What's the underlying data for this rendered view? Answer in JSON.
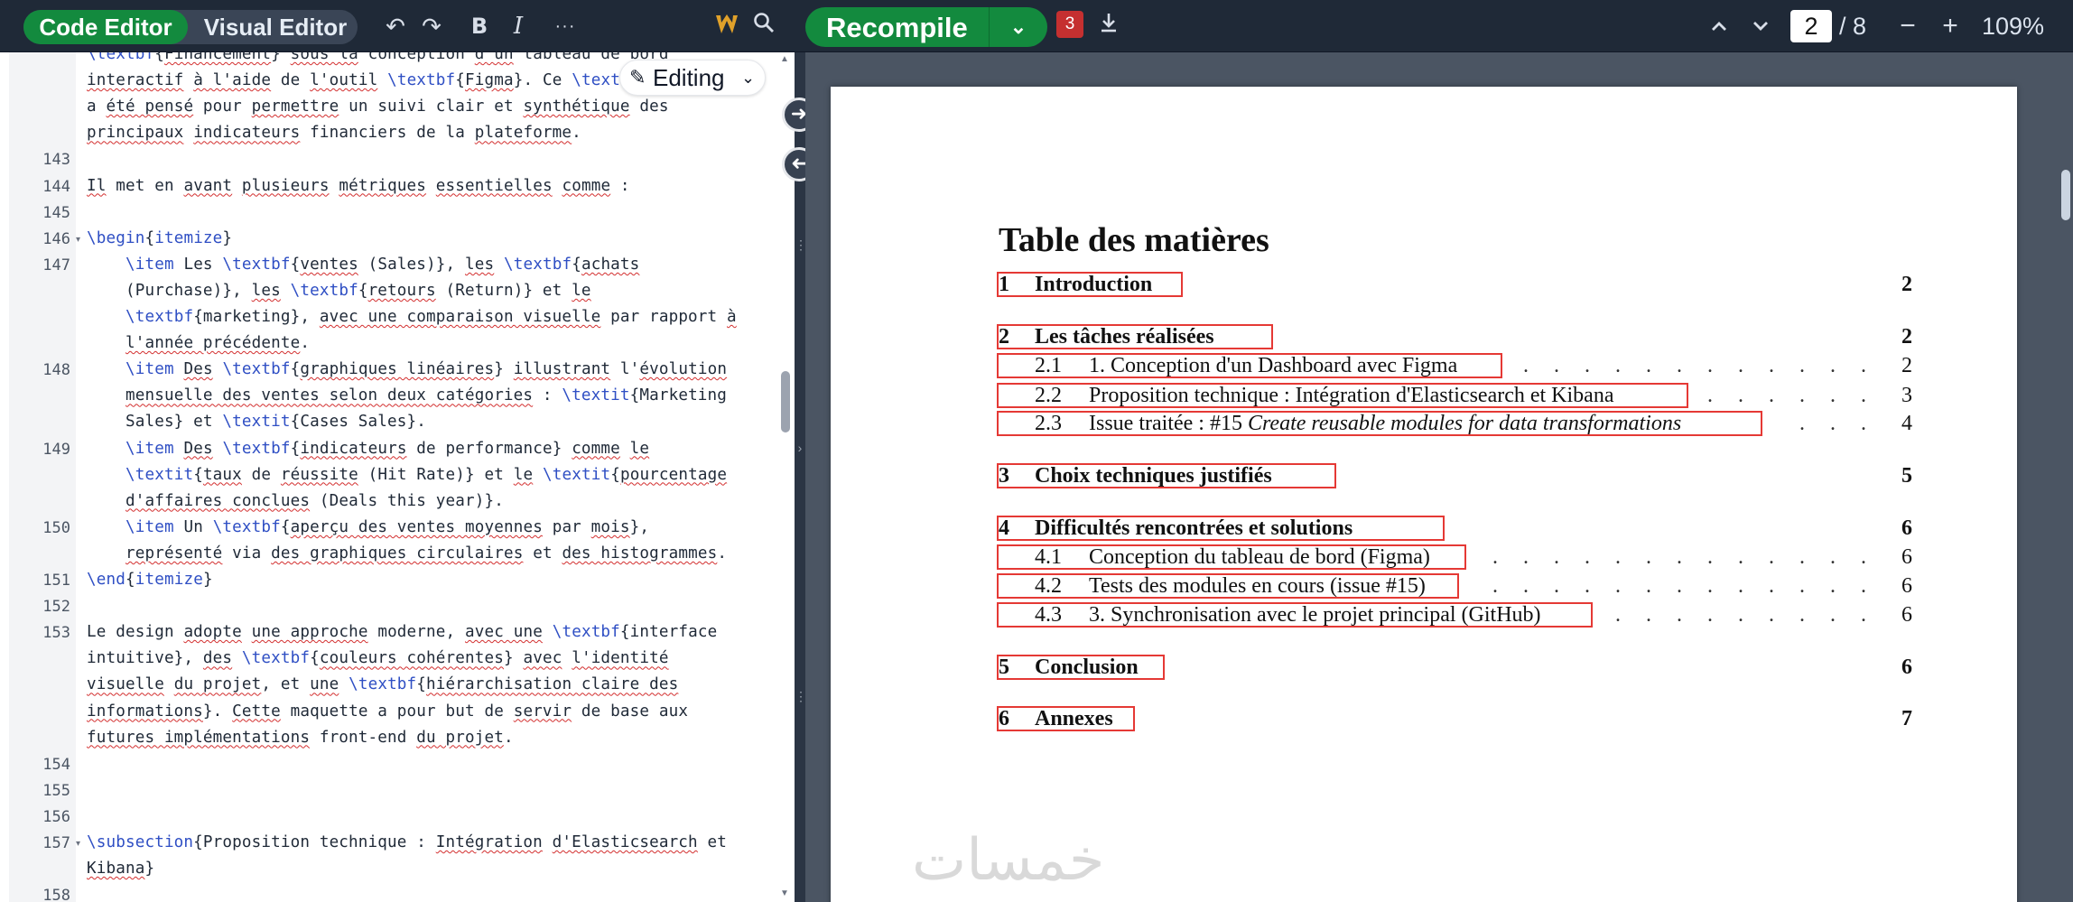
{
  "toolbar": {
    "code_editor_label": "Code Editor",
    "visual_editor_label": "Visual Editor",
    "undo_icon": "↶",
    "redo_icon": "↷",
    "bold_label": "B",
    "italic_label": "I",
    "more_icon": "···",
    "recompile_label": "Recompile",
    "errors_count": "3",
    "page_current": "2",
    "page_total": "/ 8",
    "zoom_level": "109%",
    "zoom_out": "−",
    "zoom_in": "+",
    "editing_label": "Editing"
  },
  "editor": {
    "lines": [
      {
        "n": "",
        "fold": false,
        "html": "<span class=\"k\">\\textbf</span>{<span class=\"s\">Financement</span>} <span class=\"s\">sous la</span> conception <span class=\"s\">d'un</span> tableau de <span class=\"s\">bord</span>"
      },
      {
        "n": "",
        "fold": false,
        "html": "<span class=\"s\">interactif</span> <span class=\"s\">à l'aide</span> de <span class=\"s\">l'outil</span> <span class=\"k\">\\textbf</span>{<span class=\"s\">Figma</span>}. Ce <span class=\"k\">\\textbf</span>"
      },
      {
        "n": "",
        "fold": false,
        "html": "a <span class=\"s\">été pensé</span> pour <span class=\"s\">permettre</span> un suivi clair et <span class=\"s\">synthétique</span> des"
      },
      {
        "n": "",
        "fold": false,
        "html": "<span class=\"s\">principaux</span> <span class=\"s\">indicateurs</span> financiers de la <span class=\"s\">plateforme</span>."
      },
      {
        "n": "143",
        "fold": false,
        "html": ""
      },
      {
        "n": "144",
        "fold": false,
        "html": "<span class=\"s\">Il</span> met en <span class=\"s\">avant</span> <span class=\"s\">plusieurs</span> <span class=\"s\">métriques</span> <span class=\"s\">essentielles</span> <span class=\"s\">comme</span> :"
      },
      {
        "n": "145",
        "fold": false,
        "html": ""
      },
      {
        "n": "146",
        "fold": true,
        "html": "<span class=\"k\">\\begin</span>{<span class=\"k\">itemize</span>}"
      },
      {
        "n": "147",
        "fold": false,
        "html": "    <span class=\"k\">\\item</span> Les <span class=\"k\">\\textbf</span>{<span class=\"s\">ventes</span> (Sales)}, <span class=\"s\">les</span> <span class=\"k\">\\textbf</span>{<span class=\"s\">achats</span>"
      },
      {
        "n": "",
        "fold": false,
        "html": "    (Purchase)}, <span class=\"s\">les</span> <span class=\"k\">\\textbf</span>{<span class=\"s\">retours</span> (Return)} et <span class=\"s\">le</span>"
      },
      {
        "n": "",
        "fold": false,
        "html": "    <span class=\"k\">\\textbf</span>{marketing}, <span class=\"s\">avec une comparaison visuelle</span> par rapport <span class=\"s\">à</span>"
      },
      {
        "n": "",
        "fold": false,
        "html": "    <span class=\"s\">l'année précédente</span>."
      },
      {
        "n": "148",
        "fold": false,
        "html": "    <span class=\"k\">\\item</span> <span class=\"s\">Des</span> <span class=\"k\">\\textbf</span>{<span class=\"s\">graphiques linéaires</span>} <span class=\"s\">illustrant</span> l'<span class=\"s\">évolution</span>"
      },
      {
        "n": "",
        "fold": false,
        "html": "    <span class=\"s\">mensuelle des ventes selon deux catégories</span> : <span class=\"k\">\\textit</span>{Marketing"
      },
      {
        "n": "",
        "fold": false,
        "html": "    Sales} et <span class=\"k\">\\textit</span>{Cases Sales}."
      },
      {
        "n": "149",
        "fold": false,
        "html": "    <span class=\"k\">\\item</span> <span class=\"s\">Des</span> <span class=\"k\">\\textbf</span>{<span class=\"s\">indicateurs</span> de performance} <span class=\"s\">comme</span> <span class=\"s\">le</span>"
      },
      {
        "n": "",
        "fold": false,
        "html": "    <span class=\"k\">\\textit</span>{<span class=\"s\">taux</span> de <span class=\"s\">réussite</span> (Hit Rate)} et <span class=\"s\">le</span> <span class=\"k\">\\textit</span>{<span class=\"s\">pourcentage</span>"
      },
      {
        "n": "",
        "fold": false,
        "html": "    <span class=\"s\">d'affaires conclues</span> (Deals this year)}."
      },
      {
        "n": "150",
        "fold": false,
        "html": "    <span class=\"k\">\\item</span> Un <span class=\"k\">\\textbf</span>{<span class=\"s\">aperçu des ventes moyennes</span> par <span class=\"s\">mois</span>},"
      },
      {
        "n": "",
        "fold": false,
        "html": "    <span class=\"s\">représenté</span> via <span class=\"s\">des graphiques circulaires</span> et <span class=\"s\">des histogrammes</span>."
      },
      {
        "n": "151",
        "fold": false,
        "html": "<span class=\"k\">\\end</span>{<span class=\"k\">itemize</span>}"
      },
      {
        "n": "152",
        "fold": false,
        "html": ""
      },
      {
        "n": "153",
        "fold": false,
        "html": "Le design <span class=\"s\">adopte</span> <span class=\"s\">une approche</span> moderne, <span class=\"s\">avec une</span> <span class=\"k\">\\textbf</span>{interface"
      },
      {
        "n": "",
        "fold": false,
        "html": "intuitive}, <span class=\"s\">des</span> <span class=\"k\">\\textbf</span>{<span class=\"s\">couleurs cohérentes</span>} <span class=\"s\">avec</span> <span class=\"s\">l'identité</span>"
      },
      {
        "n": "",
        "fold": false,
        "html": "<span class=\"s\">visuelle</span> <span class=\"s\">du projet</span>, et <span class=\"s\">une</span> <span class=\"k\">\\textbf</span>{<span class=\"s\">hiérarchisation claire des</span>"
      },
      {
        "n": "",
        "fold": false,
        "html": "<span class=\"s\">informations</span>}. <span class=\"s\">Cette</span> maquette a pour but de <span class=\"s\">servir</span> de base aux"
      },
      {
        "n": "",
        "fold": false,
        "html": "<span class=\"s\">futures implémentations</span> front-end <span class=\"s\">du projet</span>."
      },
      {
        "n": "154",
        "fold": false,
        "html": ""
      },
      {
        "n": "155",
        "fold": false,
        "html": ""
      },
      {
        "n": "156",
        "fold": false,
        "html": ""
      },
      {
        "n": "157",
        "fold": true,
        "html": "<span class=\"k\">\\subsection</span>{Proposition technique : <span class=\"s\">Intégration</span> <span class=\"s\">d'Elasticsearch</span> et"
      },
      {
        "n": "",
        "fold": false,
        "html": "<span class=\"s\">Kibana</span>}"
      },
      {
        "n": "158",
        "fold": false,
        "html": ""
      }
    ]
  },
  "pdf": {
    "toc_title": "Table des matières",
    "entries": [
      {
        "level": "sec",
        "num": "1",
        "title": "Introduction",
        "title_italic": "",
        "page": "2",
        "dots": false
      },
      {
        "level": "sec",
        "num": "2",
        "title": "Les tâches réalisées",
        "title_italic": "",
        "page": "2",
        "dots": false
      },
      {
        "level": "sub",
        "num": "2.1",
        "title": "1. Conception d'un Dashboard avec Figma",
        "title_italic": "",
        "page": "2",
        "dots": true
      },
      {
        "level": "sub",
        "num": "2.2",
        "title": "Proposition technique : Intégration d'Elasticsearch et Kibana",
        "title_italic": "",
        "page": "3",
        "dots": true
      },
      {
        "level": "sub",
        "num": "2.3",
        "title": "Issue traitée : #15 ",
        "title_italic": "Create reusable modules for data transformations",
        "page": "4",
        "dots": true
      },
      {
        "level": "sec",
        "num": "3",
        "title": "Choix techniques justifiés",
        "title_italic": "",
        "page": "5",
        "dots": false
      },
      {
        "level": "sec",
        "num": "4",
        "title": "Difficultés rencontrées et solutions",
        "title_italic": "",
        "page": "6",
        "dots": false
      },
      {
        "level": "sub",
        "num": "4.1",
        "title": "Conception du tableau de bord (Figma)",
        "title_italic": "",
        "page": "6",
        "dots": true
      },
      {
        "level": "sub",
        "num": "4.2",
        "title": "Tests des modules en cours (issue #15)",
        "title_italic": "",
        "page": "6",
        "dots": true
      },
      {
        "level": "sub",
        "num": "4.3",
        "title": "3. Synchronisation avec le projet principal (GitHub)",
        "title_italic": "",
        "page": "6",
        "dots": true
      },
      {
        "level": "sec",
        "num": "5",
        "title": "Conclusion",
        "title_italic": "",
        "page": "6",
        "dots": false
      },
      {
        "level": "sec",
        "num": "6",
        "title": "Annexes",
        "title_italic": "",
        "page": "7",
        "dots": false
      }
    ],
    "watermark": "خمسات"
  },
  "colors": {
    "accent_green": "#138a3e",
    "error_red": "#c53030",
    "link_box_red": "#e53935",
    "latex_command_blue": "#2f4fc4"
  }
}
